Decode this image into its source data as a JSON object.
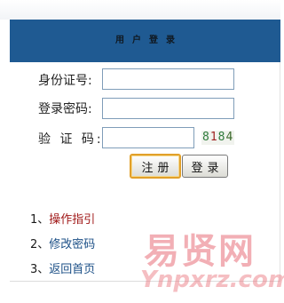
{
  "header": {
    "title": "用户登录"
  },
  "form": {
    "id_label": "身份证号:",
    "password_label": "登录密码:",
    "code_label": "验 证 码:",
    "id_value": "",
    "password_value": "",
    "code_value": "",
    "captcha_chars": [
      "8",
      "1",
      "8",
      "4"
    ]
  },
  "buttons": {
    "register_label": "注册",
    "login_label": "登录"
  },
  "links": [
    {
      "index": "1、",
      "label": "操作指引",
      "color": "#a01818"
    },
    {
      "index": "2、",
      "label": "修改密码",
      "color": "#1b4f86"
    },
    {
      "index": "3、",
      "label": "返回首页",
      "color": "#1b4f86"
    }
  ],
  "watermark": {
    "text_cn": "易贤网",
    "text_en": "Ynpxrz.com"
  },
  "colors": {
    "header_bg": "#1f5a92",
    "register_border": "#e1a02a"
  }
}
